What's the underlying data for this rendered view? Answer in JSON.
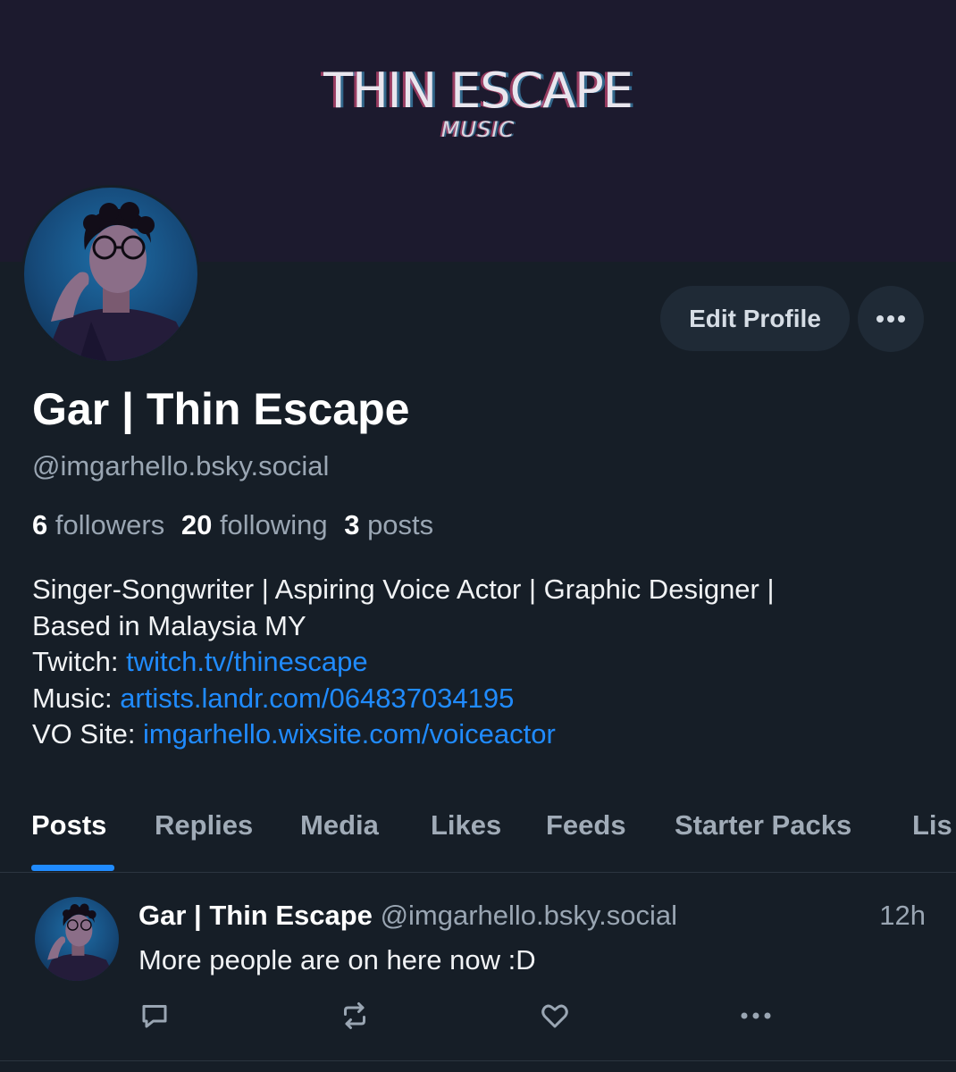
{
  "banner": {
    "title": "THIN ESCAPE",
    "subtitle": "MUSIC"
  },
  "profile": {
    "avatar_icon": "profile-photo",
    "display_name": "Gar | Thin Escape",
    "handle": "@imgarhello.bsky.social",
    "edit_label": "Edit Profile",
    "more_icon": "ellipsis-icon",
    "stats": {
      "followers_count": "6",
      "followers_label": "followers",
      "following_count": "20",
      "following_label": "following",
      "posts_count": "3",
      "posts_label": "posts"
    },
    "bio": {
      "line1": "Singer-Songwriter | Aspiring Voice Actor | Graphic Designer |",
      "line2": "Based in Malaysia MY",
      "twitch_label": "Twitch: ",
      "twitch_link": "twitch.tv/thinescape",
      "music_label": "Music: ",
      "music_link": "artists.landr.com/064837034195",
      "vo_label": "VO Site: ",
      "vo_link": "imgarhello.wixsite.com/voiceactor"
    }
  },
  "tabs": [
    "Posts",
    "Replies",
    "Media",
    "Likes",
    "Feeds",
    "Starter Packs",
    "Lis"
  ],
  "active_tab": "Posts",
  "post": {
    "author": "Gar | Thin Escape",
    "handle": "@imgarhello.bsky.social",
    "time": "12h",
    "text": "More people are on here now :D",
    "actions": [
      "reply-icon",
      "repost-icon",
      "like-icon",
      "ellipsis-icon"
    ]
  },
  "colors": {
    "background": "#161e27",
    "banner": "#1c1a2e",
    "link": "#208bfe",
    "muted": "#9aa6b3",
    "button": "#1f2a36"
  }
}
